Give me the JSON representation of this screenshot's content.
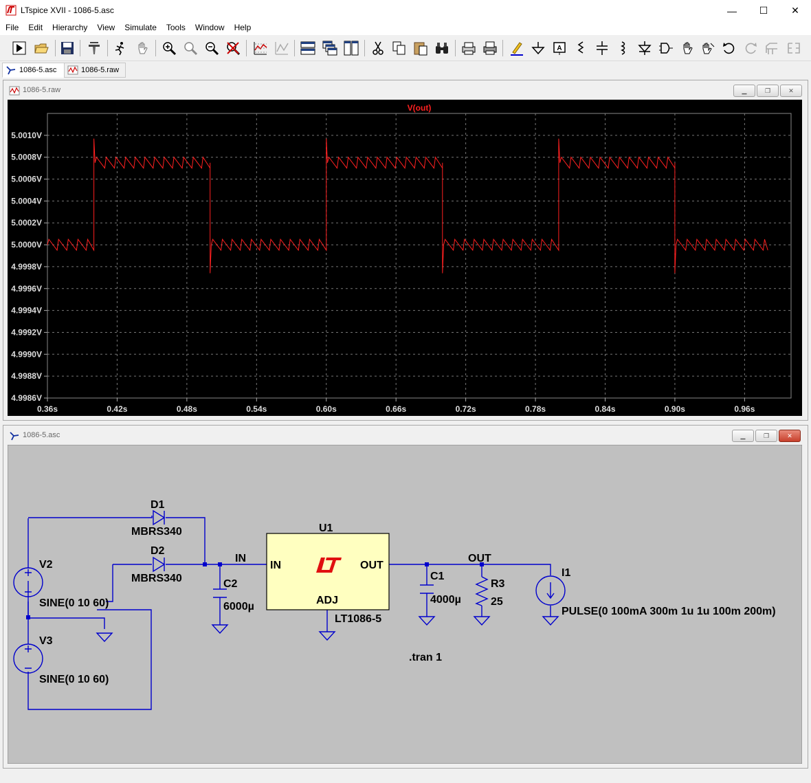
{
  "window": {
    "title": "LTspice XVII - 1086-5.asc",
    "minimize": "—",
    "maximize": "☐",
    "close": "✕"
  },
  "menu": [
    "File",
    "Edit",
    "Hierarchy",
    "View",
    "Simulate",
    "Tools",
    "Window",
    "Help"
  ],
  "toolbar_icons": [
    "run-icon",
    "open-icon",
    "save-icon",
    "control-panel-icon",
    "halt-icon",
    "pan-icon",
    "zoom-in-icon",
    "zoom-full-icon",
    "zoom-out-icon",
    "zoom-cancel-icon",
    "autorange-icon",
    "plot-settings-icon",
    "tile-horizontal-icon",
    "cascade-icon",
    "tile-vertical-icon",
    "cut-icon",
    "copy-icon",
    "paste-icon",
    "find-icon",
    "print-preview-icon",
    "print-icon",
    "draw-wire-icon",
    "ground-icon",
    "label-net-icon",
    "resistor-icon",
    "capacitor-icon",
    "inductor-icon",
    "diode-icon",
    "component-icon",
    "move-icon",
    "drag-icon",
    "undo-icon",
    "redo-icon",
    "rotate-icon",
    "mirror-icon"
  ],
  "tabs": [
    {
      "label": "1086-5.asc",
      "active": true
    },
    {
      "label": "1086-5.raw",
      "active": false
    }
  ],
  "waveform_window": {
    "title": "1086-5.raw",
    "trace_label": "V(out)",
    "trace_color": "#ff2020"
  },
  "chart_data": {
    "type": "line",
    "title": "V(out)",
    "xlabel": "",
    "ylabel": "",
    "xlim": [
      0.36,
      1.0
    ],
    "ylim": [
      4.9986,
      5.0012
    ],
    "grid": true,
    "x_ticks": [
      "0.36s",
      "0.42s",
      "0.48s",
      "0.54s",
      "0.60s",
      "0.66s",
      "0.72s",
      "0.78s",
      "0.84s",
      "0.90s",
      "0.96s"
    ],
    "y_ticks": [
      "5.0010V",
      "5.0008V",
      "5.0006V",
      "5.0004V",
      "5.0002V",
      "5.0000V",
      "4.9998V",
      "4.9996V",
      "4.9994V",
      "4.9992V",
      "4.9990V",
      "4.9988V",
      "4.9986V"
    ],
    "series": [
      {
        "name": "V(out)",
        "x": [
          0.36,
          0.4,
          0.4,
          0.401,
          0.5,
          0.5,
          0.501,
          0.6,
          0.6,
          0.601,
          0.7,
          0.7,
          0.701,
          0.8,
          0.8,
          0.801,
          0.9,
          0.9,
          0.901,
          0.98
        ],
        "y": [
          5.0,
          5.0,
          5.00097,
          5.00075,
          5.00075,
          4.99974,
          5.0,
          5.0,
          5.00097,
          5.00075,
          5.00075,
          4.99974,
          5.0,
          5.0,
          5.00097,
          5.00075,
          5.00075,
          4.99974,
          5.0,
          5.0
        ],
        "ripple_hz": 120,
        "ripple_pp": 0.0001
      }
    ]
  },
  "schematic_window": {
    "title": "1086-5.asc",
    "labels": {
      "d1": "D1",
      "d1_model": "MBRS340",
      "d2": "D2",
      "d2_model": "MBRS340",
      "v2": "V2",
      "v2_value": "SINE(0 10 60)",
      "v3": "V3",
      "v3_value": "SINE(0 10 60)",
      "c2": "C2",
      "c2_value": "6000µ",
      "in_net": "IN",
      "u1": "U1",
      "u1_pin_in": "IN",
      "u1_pin_out": "OUT",
      "u1_pin_adj": "ADJ",
      "u1_part": "LT1086-5",
      "out_net": "OUT",
      "c1": "C1",
      "c1_value": "4000µ",
      "r3": "R3",
      "r3_value": "25",
      "i1": "I1",
      "i1_value": "PULSE(0 100mA 300m 1u 1u 100m 200m)",
      "directive": ".tran 1"
    },
    "colors": {
      "wire": "#0000cc",
      "component": "#0000cc",
      "background": "#c0c0c0",
      "ic_fill": "#ffffc0",
      "logo": "#e01010"
    }
  }
}
